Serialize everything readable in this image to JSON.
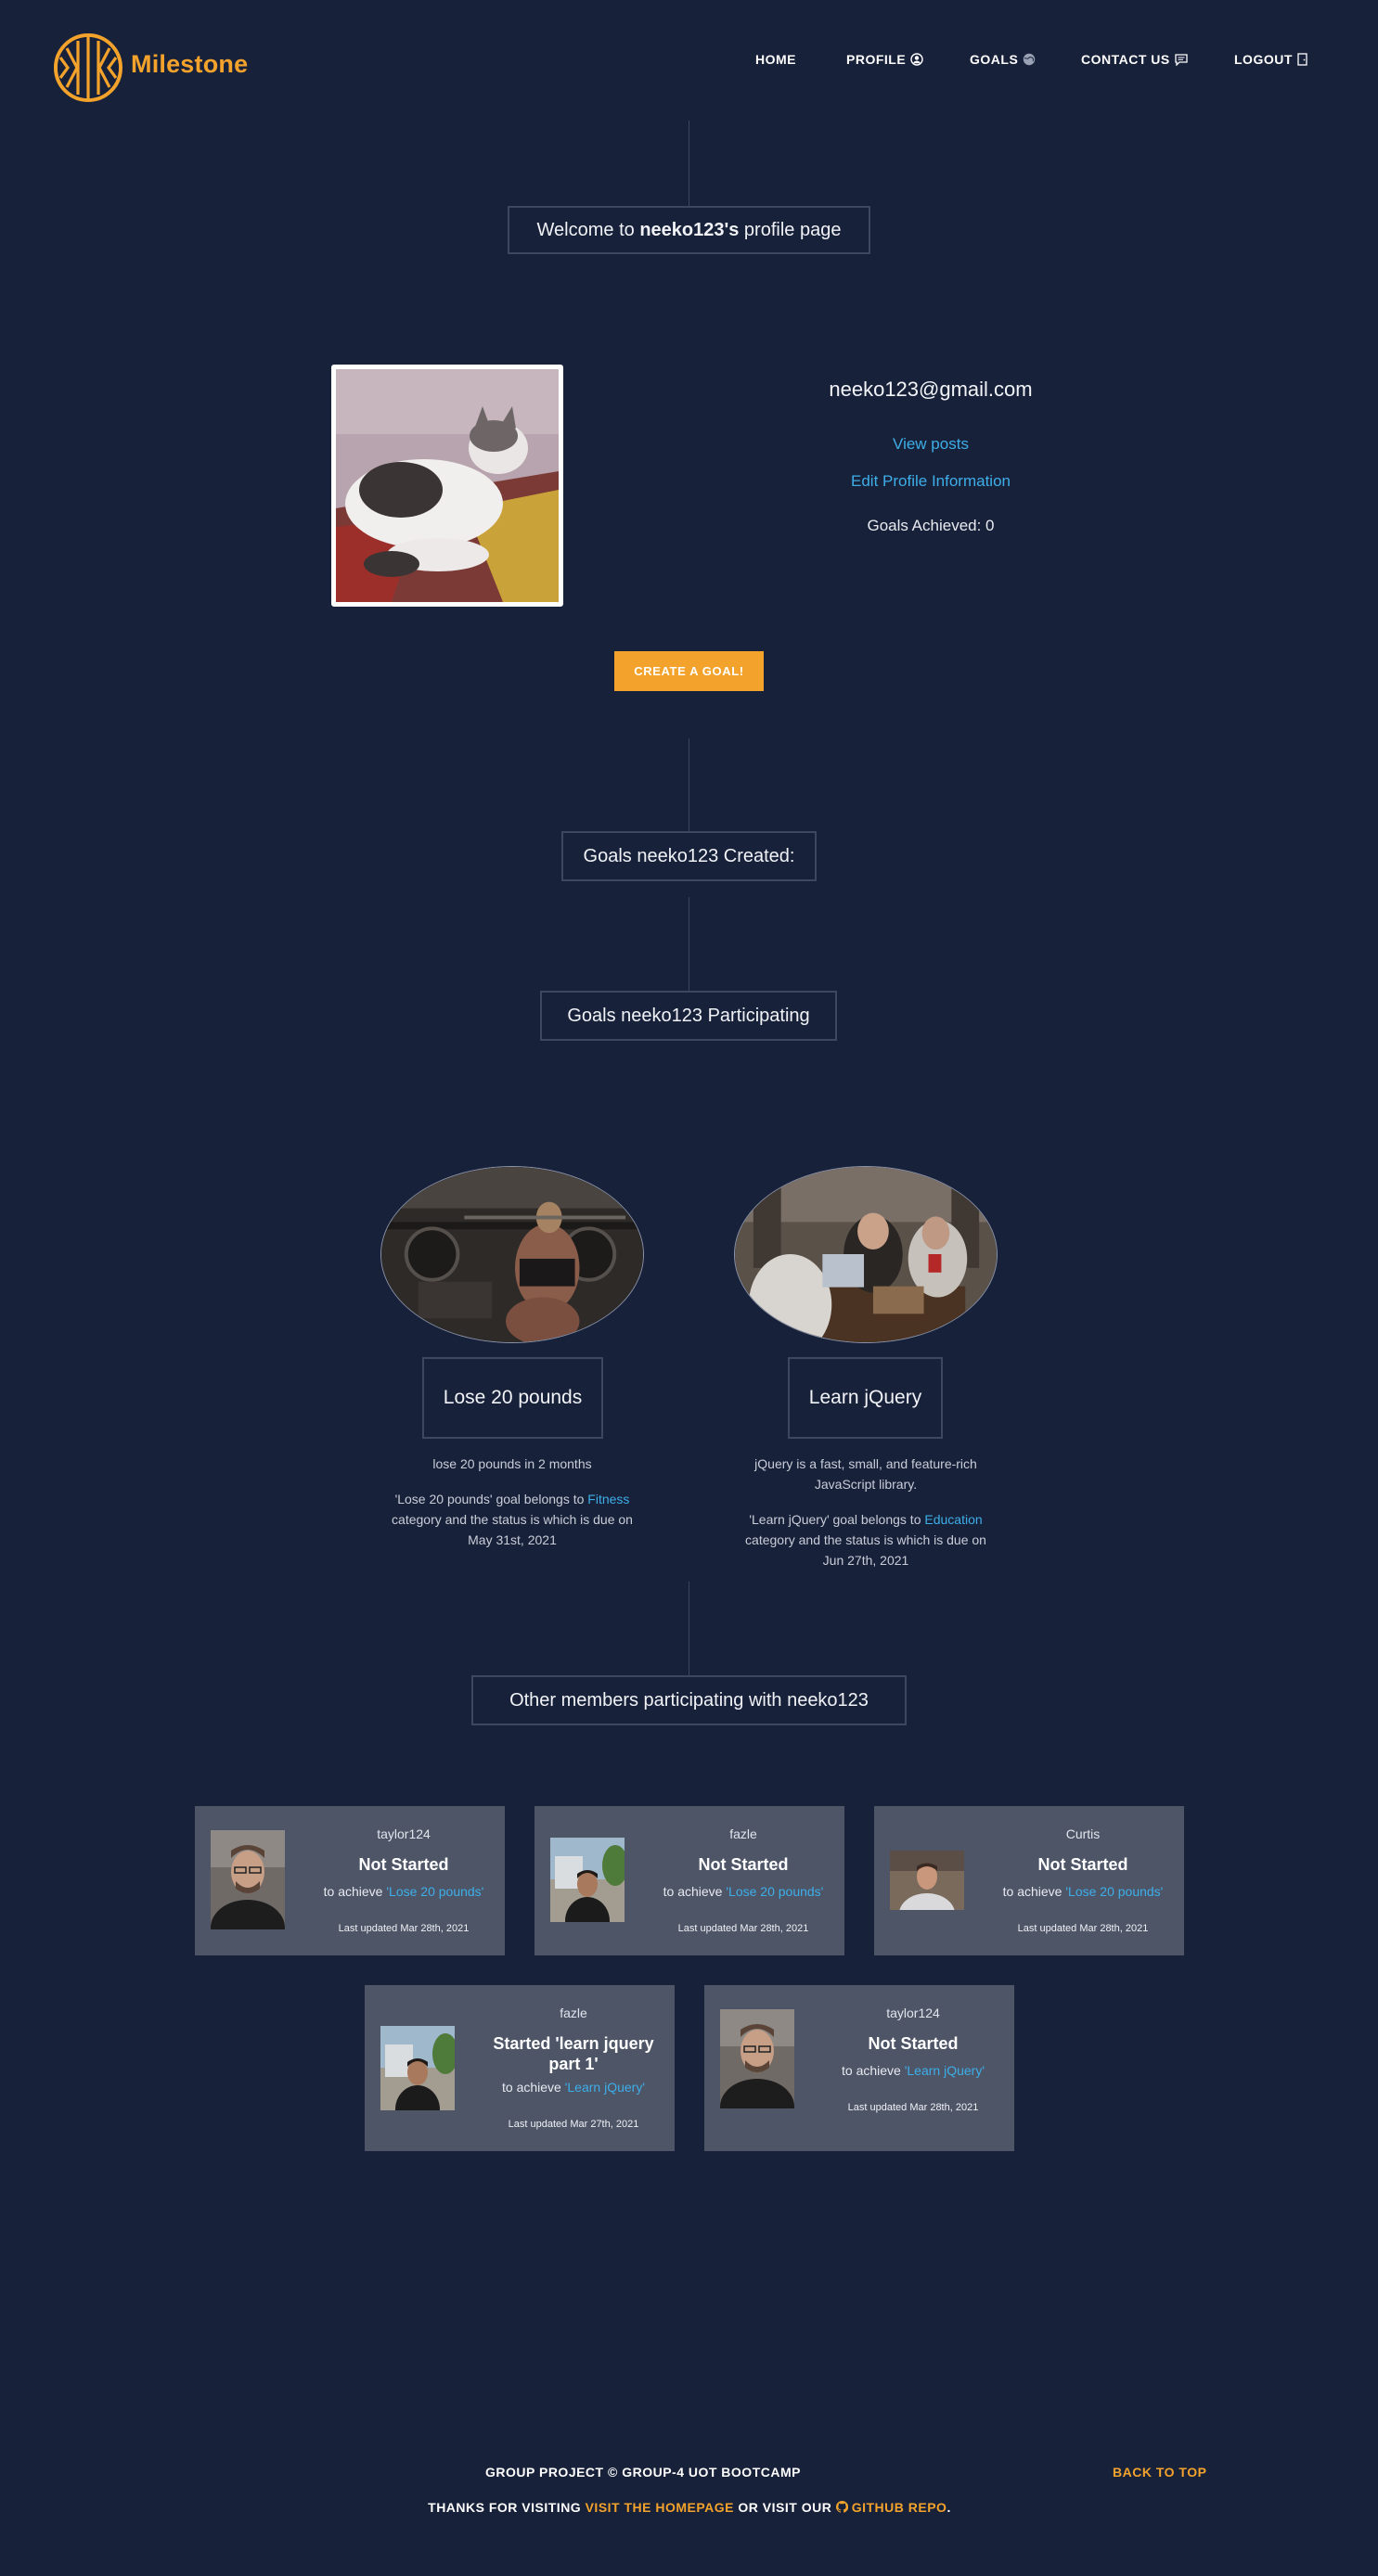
{
  "header": {
    "brand": "Milestone",
    "nav": {
      "home": "HOME",
      "profile": "PROFILE",
      "goals": "GOALS",
      "contact": "CONTACT US",
      "logout": "LOGOUT"
    }
  },
  "welcome": {
    "prefix": "Welcome to ",
    "user": "neeko123's",
    "suffix": " profile page"
  },
  "profile": {
    "email": "neeko123@gmail.com",
    "view_posts": "View posts",
    "edit_profile": "Edit Profile Information",
    "goals_achieved": "Goals Achieved: 0",
    "create_goal": "CREATE A GOAL!"
  },
  "sections": {
    "created": "Goals neeko123 Created:",
    "participating": "Goals neeko123 Participating",
    "others": "Other members participating with neeko123"
  },
  "goals": [
    {
      "title": "Lose 20 pounds",
      "description": "lose 20 pounds in 2 months",
      "belongs_prefix": "'Lose 20 pounds' goal belongs to ",
      "category": "Fitness",
      "belongs_suffix": "category and the status is which is due on May 31st, 2021"
    },
    {
      "title": "Learn jQuery",
      "description": "jQuery is a fast, small, and feature-rich JavaScript library.",
      "belongs_prefix": "'Learn jQuery' goal belongs to ",
      "category": "Education",
      "belongs_suffix": "category and the status is which is due on Jun 27th, 2021"
    }
  ],
  "members": [
    {
      "name": "taylor124",
      "status": "Not Started",
      "achieve_prefix": "to achieve ",
      "goal": "'Lose 20 pounds'",
      "updated": "Last updated Mar 28th, 2021"
    },
    {
      "name": "fazle",
      "status": "Not Started",
      "achieve_prefix": "to achieve ",
      "goal": "'Lose 20 pounds'",
      "updated": "Last updated Mar 28th, 2021"
    },
    {
      "name": "Curtis",
      "status": "Not Started",
      "achieve_prefix": "to achieve ",
      "goal": "'Lose 20 pounds'",
      "updated": "Last updated Mar 28th, 2021"
    },
    {
      "name": "fazle",
      "status": "Started 'learn jquery part 1'",
      "achieve_prefix": "to achieve ",
      "goal": "'Learn jQuery'",
      "updated": "Last updated Mar 27th, 2021"
    },
    {
      "name": "taylor124",
      "status": "Not Started",
      "achieve_prefix": "to achieve ",
      "goal": "'Learn jQuery'",
      "updated": "Last updated Mar 28th, 2021"
    }
  ],
  "footer": {
    "credit": "GROUP PROJECT © GROUP-4 UOT BOOTCAMP",
    "back_to_top": "BACK TO TOP",
    "thanks": "THANKS FOR VISITING ",
    "homepage": "VISIT THE HOMEPAGE",
    "or_visit": " OR VISIT OUR ",
    "github": "GITHUB REPO",
    "period": "."
  },
  "colors": {
    "background": "#18213a",
    "accent": "#f3a32b",
    "link": "#3eaee8",
    "card": "#4d5567"
  }
}
